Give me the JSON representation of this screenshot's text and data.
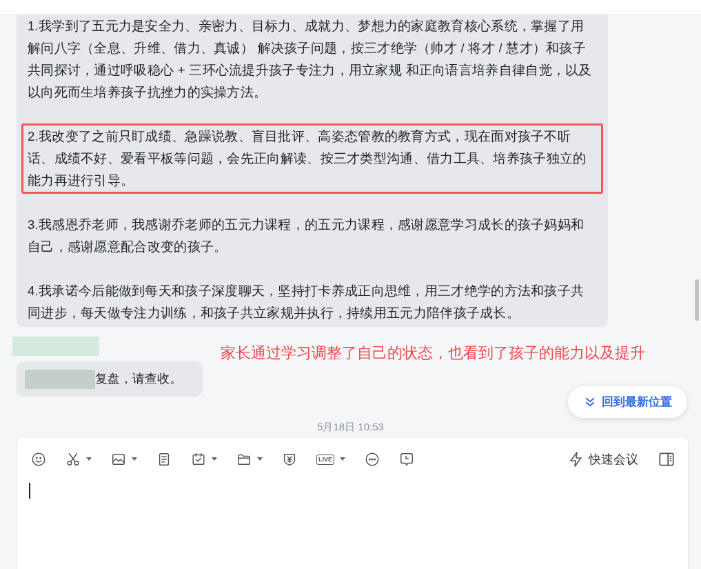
{
  "message": {
    "paragraphs": [
      {
        "text": "1.我学到了五元力是安全力、亲密力、目标力、成就力、梦想力的家庭教育核心系统，掌握了用解问八字（全息、升维、借力、真诚） 解决孩子问题，按三才绝学（帅才 / 将才 / 慧才）和孩子共同探讨，通过呼吸稳心 + 三环心流提升孩子专注力，用立家规 和正向语言培养自律自觉，以及以向死而生培养孩子抗挫力的实操方法。",
        "highlighted": false
      },
      {
        "text": "2.我改变了之前只盯成绩、急躁说教、盲目批评、高姿态管教的教育方式，现在面对孩子不听话、成绩不好、爱看平板等问题，会先正向解读、按三才类型沟通、借力工具、培养孩子独立的能力再进行引导。",
        "highlighted": true
      },
      {
        "text": "3.我感恩乔老师，我感谢乔老师的五元力课程，的五元力课程，感谢愿意学习成长的孩子妈妈和自己，感谢愿意配合改变的孩子。",
        "highlighted": false
      },
      {
        "text": "4.我承诺今后能做到每天和孩子深度聊天，坚持打卡养成正向思维，用三才绝学的方法和孩子共同进步，每天做专注力训练，和孩子共立家规并执行，持续用五元力陪伴孩子成长。",
        "highlighted": false
      }
    ]
  },
  "reply": {
    "text": "复盘，请查收。"
  },
  "annotation": "家长通过学习调整了自己的状态，也看到了孩子的能力以及提升",
  "jump_button": "回到最新位置",
  "timestamp": "5月18日 10:53",
  "composer": {
    "tools": [
      {
        "has_menu": false
      },
      {
        "has_menu": true
      },
      {
        "has_menu": true
      },
      {
        "has_menu": false
      },
      {
        "has_menu": true
      },
      {
        "has_menu": true
      },
      {
        "has_menu": false
      },
      {
        "has_menu": true,
        "label": "LIVE"
      },
      {
        "has_menu": false
      },
      {
        "has_menu": false
      }
    ],
    "meeting_button": "快速会议"
  }
}
